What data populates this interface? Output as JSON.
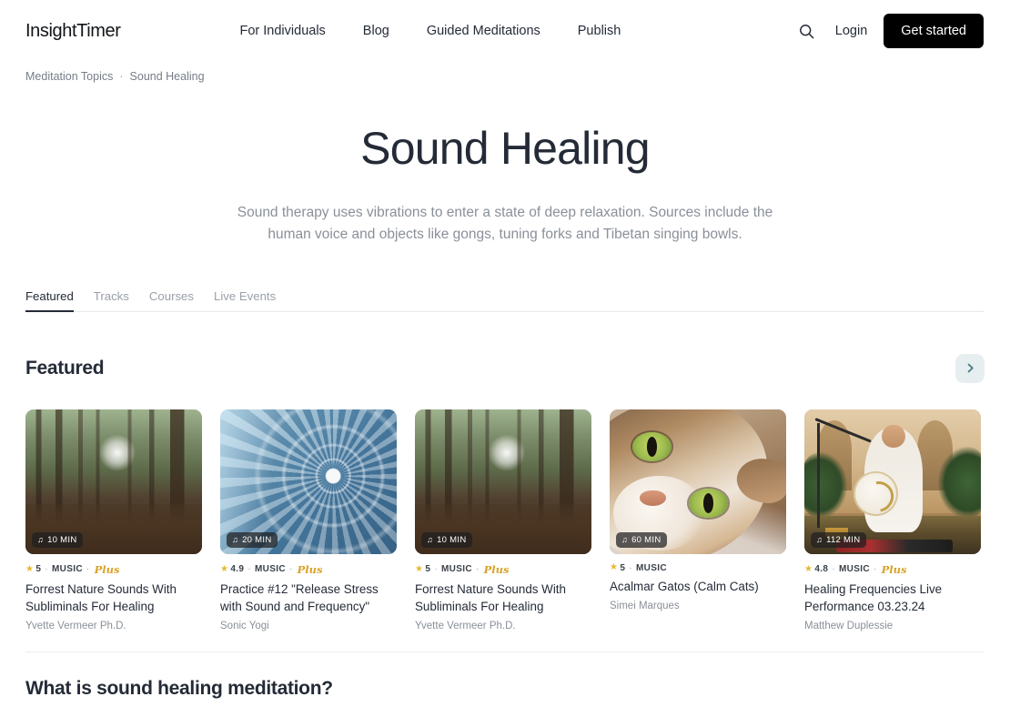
{
  "header": {
    "logo": "InsightTimer",
    "nav": [
      {
        "label": "For Individuals"
      },
      {
        "label": "Blog"
      },
      {
        "label": "Guided Meditations"
      },
      {
        "label": "Publish"
      }
    ],
    "search_icon": "search-icon",
    "login_label": "Login",
    "get_started_label": "Get started"
  },
  "breadcrumb": {
    "parent": "Meditation Topics",
    "separator": "·",
    "current": "Sound Healing"
  },
  "hero": {
    "title": "Sound Healing",
    "description": "Sound therapy uses vibrations to enter a state of deep relaxation. Sources include the human voice and objects like gongs, tuning forks and Tibetan singing bowls."
  },
  "tabs": [
    {
      "label": "Featured",
      "active": true
    },
    {
      "label": "Tracks",
      "active": false
    },
    {
      "label": "Courses",
      "active": false
    },
    {
      "label": "Live Events",
      "active": false
    }
  ],
  "featured_section": {
    "title": "Featured",
    "next_icon": "chevron-right-icon",
    "accent_color": "#e7eef0",
    "chevron_color": "#3d7a7e",
    "cards": [
      {
        "duration": "10 MIN",
        "duration_icon": "music-note-icon",
        "rating": "5",
        "category": "MUSIC",
        "plus_badge": "Plus",
        "title": "Forrest Nature Sounds With Subliminals For Healing",
        "author": "Yvette Vermeer Ph.D.",
        "art": "forest"
      },
      {
        "duration": "20 MIN",
        "duration_icon": "music-note-icon",
        "rating": "4.9",
        "category": "MUSIC",
        "plus_badge": "Plus",
        "title": "Practice #12 \"Release Stress with Sound and Frequency\"",
        "author": "Sonic Yogi",
        "art": "stairs"
      },
      {
        "duration": "10 MIN",
        "duration_icon": "music-note-icon",
        "rating": "5",
        "category": "MUSIC",
        "plus_badge": "Plus",
        "title": "Forrest Nature Sounds With Subliminals For Healing",
        "author": "Yvette Vermeer Ph.D.",
        "art": "forest"
      },
      {
        "duration": "60 MIN",
        "duration_icon": "music-note-icon",
        "rating": "5",
        "category": "MUSIC",
        "plus_badge": "",
        "title": "Acalmar Gatos (Calm Cats)",
        "author": "Simei Marques",
        "art": "cat"
      },
      {
        "duration": "112 MIN",
        "duration_icon": "music-note-icon",
        "rating": "4.8",
        "category": "MUSIC",
        "plus_badge": "Plus",
        "title": "Healing Frequencies Live Performance 03.23.24",
        "author": "Matthew Duplessie",
        "art": "healer"
      }
    ]
  },
  "bottom_section": {
    "title": "What is sound healing meditation?"
  },
  "symbols": {
    "star": "★",
    "music_note": "♫",
    "dot": "·"
  }
}
